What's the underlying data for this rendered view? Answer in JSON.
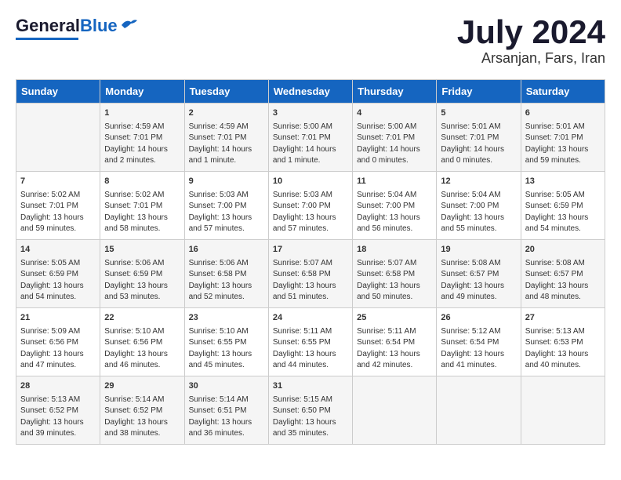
{
  "header": {
    "logo_general": "General",
    "logo_blue": "Blue",
    "month": "July 2024",
    "location": "Arsanjan, Fars, Iran"
  },
  "days_of_week": [
    "Sunday",
    "Monday",
    "Tuesday",
    "Wednesday",
    "Thursday",
    "Friday",
    "Saturday"
  ],
  "weeks": [
    [
      {
        "day": "",
        "data": ""
      },
      {
        "day": "1",
        "data": "Sunrise: 4:59 AM\nSunset: 7:01 PM\nDaylight: 14 hours\nand 2 minutes."
      },
      {
        "day": "2",
        "data": "Sunrise: 4:59 AM\nSunset: 7:01 PM\nDaylight: 14 hours\nand 1 minute."
      },
      {
        "day": "3",
        "data": "Sunrise: 5:00 AM\nSunset: 7:01 PM\nDaylight: 14 hours\nand 1 minute."
      },
      {
        "day": "4",
        "data": "Sunrise: 5:00 AM\nSunset: 7:01 PM\nDaylight: 14 hours\nand 0 minutes."
      },
      {
        "day": "5",
        "data": "Sunrise: 5:01 AM\nSunset: 7:01 PM\nDaylight: 14 hours\nand 0 minutes."
      },
      {
        "day": "6",
        "data": "Sunrise: 5:01 AM\nSunset: 7:01 PM\nDaylight: 13 hours\nand 59 minutes."
      }
    ],
    [
      {
        "day": "7",
        "data": "Sunrise: 5:02 AM\nSunset: 7:01 PM\nDaylight: 13 hours\nand 59 minutes."
      },
      {
        "day": "8",
        "data": "Sunrise: 5:02 AM\nSunset: 7:01 PM\nDaylight: 13 hours\nand 58 minutes."
      },
      {
        "day": "9",
        "data": "Sunrise: 5:03 AM\nSunset: 7:00 PM\nDaylight: 13 hours\nand 57 minutes."
      },
      {
        "day": "10",
        "data": "Sunrise: 5:03 AM\nSunset: 7:00 PM\nDaylight: 13 hours\nand 57 minutes."
      },
      {
        "day": "11",
        "data": "Sunrise: 5:04 AM\nSunset: 7:00 PM\nDaylight: 13 hours\nand 56 minutes."
      },
      {
        "day": "12",
        "data": "Sunrise: 5:04 AM\nSunset: 7:00 PM\nDaylight: 13 hours\nand 55 minutes."
      },
      {
        "day": "13",
        "data": "Sunrise: 5:05 AM\nSunset: 6:59 PM\nDaylight: 13 hours\nand 54 minutes."
      }
    ],
    [
      {
        "day": "14",
        "data": "Sunrise: 5:05 AM\nSunset: 6:59 PM\nDaylight: 13 hours\nand 54 minutes."
      },
      {
        "day": "15",
        "data": "Sunrise: 5:06 AM\nSunset: 6:59 PM\nDaylight: 13 hours\nand 53 minutes."
      },
      {
        "day": "16",
        "data": "Sunrise: 5:06 AM\nSunset: 6:58 PM\nDaylight: 13 hours\nand 52 minutes."
      },
      {
        "day": "17",
        "data": "Sunrise: 5:07 AM\nSunset: 6:58 PM\nDaylight: 13 hours\nand 51 minutes."
      },
      {
        "day": "18",
        "data": "Sunrise: 5:07 AM\nSunset: 6:58 PM\nDaylight: 13 hours\nand 50 minutes."
      },
      {
        "day": "19",
        "data": "Sunrise: 5:08 AM\nSunset: 6:57 PM\nDaylight: 13 hours\nand 49 minutes."
      },
      {
        "day": "20",
        "data": "Sunrise: 5:08 AM\nSunset: 6:57 PM\nDaylight: 13 hours\nand 48 minutes."
      }
    ],
    [
      {
        "day": "21",
        "data": "Sunrise: 5:09 AM\nSunset: 6:56 PM\nDaylight: 13 hours\nand 47 minutes."
      },
      {
        "day": "22",
        "data": "Sunrise: 5:10 AM\nSunset: 6:56 PM\nDaylight: 13 hours\nand 46 minutes."
      },
      {
        "day": "23",
        "data": "Sunrise: 5:10 AM\nSunset: 6:55 PM\nDaylight: 13 hours\nand 45 minutes."
      },
      {
        "day": "24",
        "data": "Sunrise: 5:11 AM\nSunset: 6:55 PM\nDaylight: 13 hours\nand 44 minutes."
      },
      {
        "day": "25",
        "data": "Sunrise: 5:11 AM\nSunset: 6:54 PM\nDaylight: 13 hours\nand 42 minutes."
      },
      {
        "day": "26",
        "data": "Sunrise: 5:12 AM\nSunset: 6:54 PM\nDaylight: 13 hours\nand 41 minutes."
      },
      {
        "day": "27",
        "data": "Sunrise: 5:13 AM\nSunset: 6:53 PM\nDaylight: 13 hours\nand 40 minutes."
      }
    ],
    [
      {
        "day": "28",
        "data": "Sunrise: 5:13 AM\nSunset: 6:52 PM\nDaylight: 13 hours\nand 39 minutes."
      },
      {
        "day": "29",
        "data": "Sunrise: 5:14 AM\nSunset: 6:52 PM\nDaylight: 13 hours\nand 38 minutes."
      },
      {
        "day": "30",
        "data": "Sunrise: 5:14 AM\nSunset: 6:51 PM\nDaylight: 13 hours\nand 36 minutes."
      },
      {
        "day": "31",
        "data": "Sunrise: 5:15 AM\nSunset: 6:50 PM\nDaylight: 13 hours\nand 35 minutes."
      },
      {
        "day": "",
        "data": ""
      },
      {
        "day": "",
        "data": ""
      },
      {
        "day": "",
        "data": ""
      }
    ]
  ]
}
